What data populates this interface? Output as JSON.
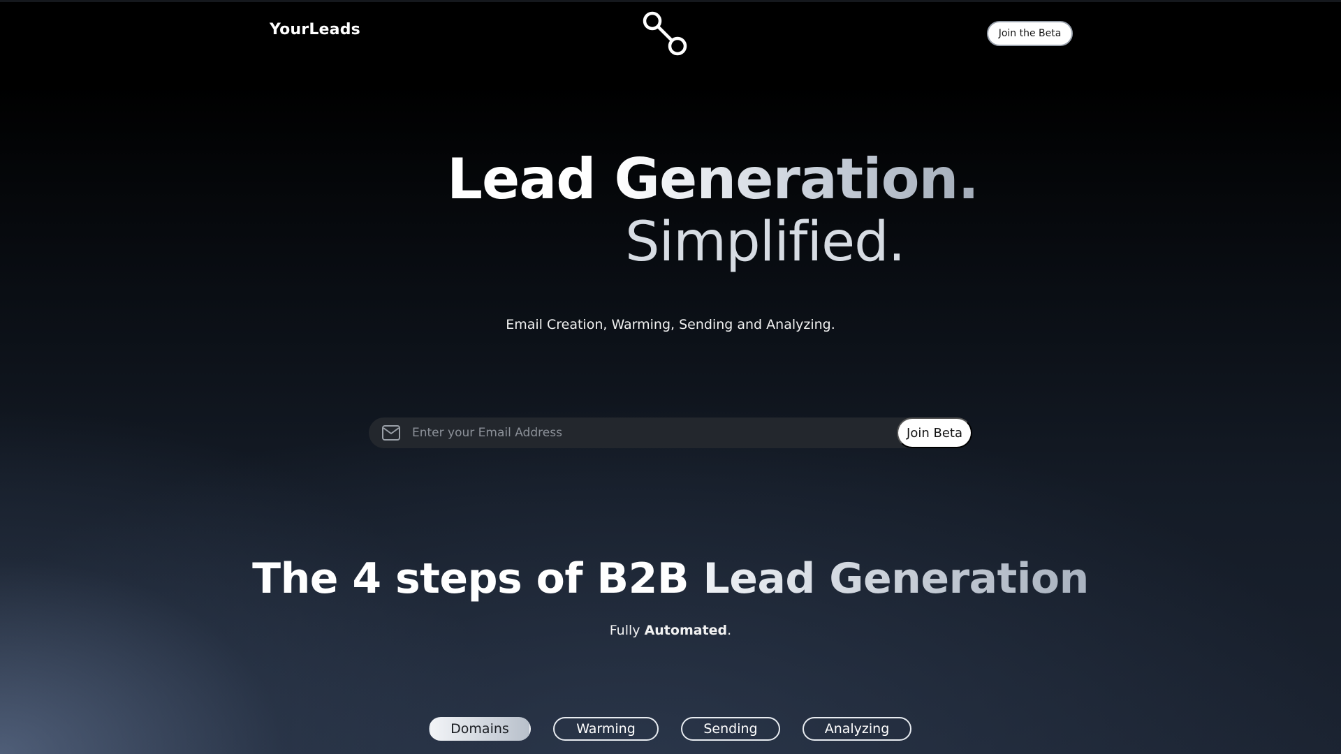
{
  "nav": {
    "brand": "YourLeads",
    "logo_icon": "link-nodes-icon",
    "cta_label": "Join the Beta"
  },
  "hero": {
    "line1_word1": "Lead",
    "line1_word2": "Generation.",
    "line2": "Simplified.",
    "tagline": "Email Creation, Warming, Sending and Analyzing."
  },
  "signup": {
    "icon": "mail-icon",
    "placeholder": "Enter your Email Address",
    "value": "",
    "button_label": "Join Beta"
  },
  "steps": {
    "title_part1": "The 4 steps of B2B",
    "title_part2": "Lead Generation",
    "subtitle_prefix": "Fully",
    "subtitle_bold": "Automated",
    "subtitle_suffix": ".",
    "tabs": [
      {
        "label": "Domains",
        "active": true
      },
      {
        "label": "Warming",
        "active": false
      },
      {
        "label": "Sending",
        "active": false
      },
      {
        "label": "Analyzing",
        "active": false
      }
    ]
  },
  "colors": {
    "background_top": "#000000",
    "background_bottom": "#1b2331",
    "accent_white": "#ffffff",
    "input_bg": "#23272d"
  }
}
